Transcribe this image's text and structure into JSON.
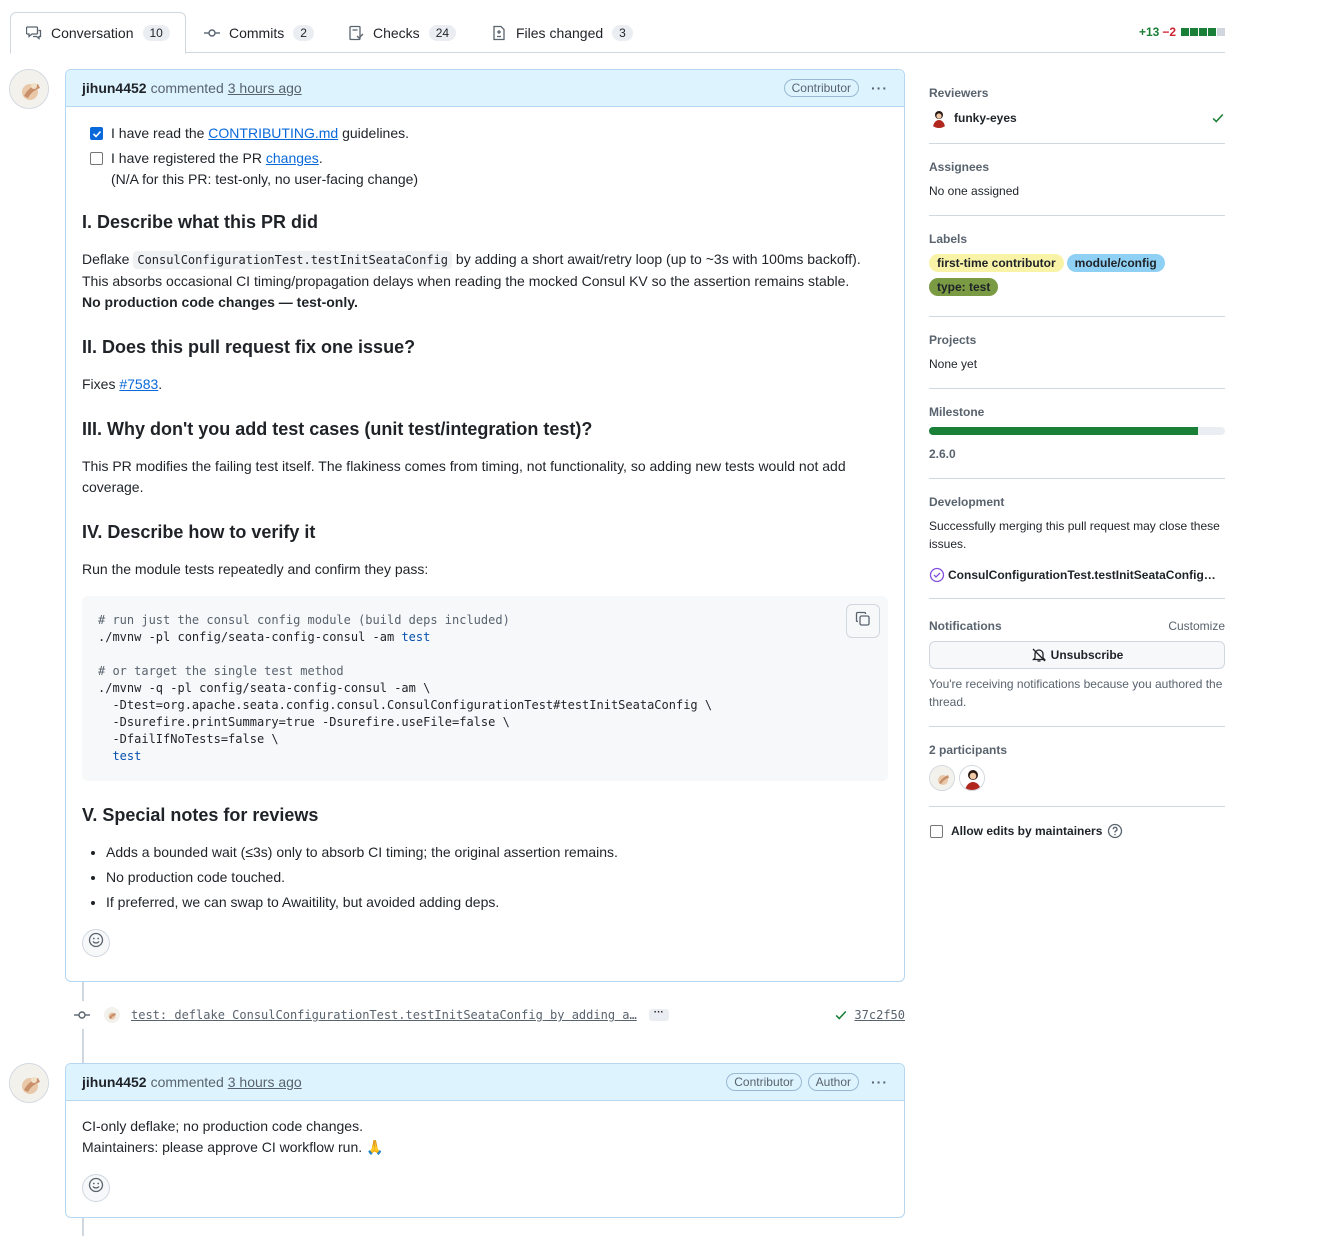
{
  "tabs": [
    {
      "label": "Conversation",
      "count": "10",
      "icon": "comment-discussion-icon"
    },
    {
      "label": "Commits",
      "count": "2",
      "icon": "git-commit-icon"
    },
    {
      "label": "Checks",
      "count": "24",
      "icon": "checklist-icon"
    },
    {
      "label": "Files changed",
      "count": "3",
      "icon": "file-diff-icon"
    }
  ],
  "diffstat": {
    "additions": "+13",
    "deletions": "−2"
  },
  "comment1": {
    "author": "jihun4452",
    "verb": "commented",
    "time": "3 hours ago",
    "badge": "Contributor",
    "check1_pre": "I have read the",
    "check1_link": "CONTRIBUTING.md",
    "check1_post": "guidelines.",
    "check2_pre": "I have registered the PR",
    "check2_link": "changes",
    "check2_note": "(N/A for this PR: test-only, no user-facing change)",
    "h1": "I. Describe what this PR did",
    "p1_pre": "Deflake",
    "p1_code": "ConsulConfigurationTest.testInitSeataConfig",
    "p1_post": "by adding a short await/retry loop (up to ~3s with 100ms backoff). This absorbs occasional CI timing/propagation delays when reading the mocked Consul KV so the assertion remains stable.",
    "p1_bold": "No production code changes — test-only.",
    "h2": "II. Does this pull request fix one issue?",
    "p2_pre": "Fixes",
    "p2_link": "#7583",
    "h3": "III. Why don't you add test cases (unit test/integration test)?",
    "p3": "This PR modifies the failing test itself. The flakiness comes from timing, not functionality, so adding new tests would not add coverage.",
    "h4": "IV. Describe how to verify it",
    "p4": "Run the module tests repeatedly and confirm they pass:",
    "code": {
      "c1": "# run just the consul config module (build deps included)",
      "l1": "./mvnw -pl config/seata-config-consul -am ",
      "l1_kw": "test",
      "c2": "# or target the single test method",
      "l2": "./mvnw -q -pl config/seata-config-consul -am \\",
      "l3": "  -Dtest=org.apache.seata.config.consul.ConsulConfigurationTest#testInitSeataConfig \\",
      "l4": "  -Dsurefire.printSummary=true -Dsurefire.useFile=false \\",
      "l5": "  -DfailIfNoTests=false \\",
      "l6_kw": "test"
    },
    "h5": "V. Special notes for reviews",
    "bullets": [
      "Adds a bounded wait (≤3s) only to absorb CI timing; the original assertion remains.",
      "No production code touched.",
      "If preferred, we can swap to Awaitility, but avoided adding deps."
    ]
  },
  "commit": {
    "message": "test: deflake ConsulConfigurationTest.testInitSeataConfig by adding a…",
    "ellipsis": "···",
    "sha": "37c2f50"
  },
  "comment2": {
    "author": "jihun4452",
    "verb": "commented",
    "time": "3 hours ago",
    "badge1": "Contributor",
    "badge2": "Author",
    "line1": "CI-only deflake; no production code changes.",
    "line2": "Maintainers: please approve CI workflow run. 🙏"
  },
  "sidebar": {
    "reviewers_title": "Reviewers",
    "reviewer": "funky-eyes",
    "assignees_title": "Assignees",
    "assignees_value": "No one assigned",
    "labels_title": "Labels",
    "labels": [
      {
        "name": "first-time contributor",
        "bg": "#f9f3a8",
        "fg": "#1f2328"
      },
      {
        "name": "module/config",
        "bg": "#8fd0f5",
        "fg": "#1f2328"
      },
      {
        "name": "type: test",
        "bg": "#7a9a43",
        "fg": "#1f2328"
      }
    ],
    "projects_title": "Projects",
    "projects_value": "None yet",
    "milestone_title": "Milestone",
    "milestone_name": "2.6.0",
    "milestone_progress": 0.91,
    "development_title": "Development",
    "development_text": "Successfully merging this pull request may close these issues.",
    "development_issue": "ConsulConfigurationTest.testInitSeataConfig…",
    "notifications_title": "Notifications",
    "customize": "Customize",
    "unsubscribe": "Unsubscribe",
    "notif_reason": "You're receiving notifications because you authored the thread.",
    "participants_title": "2 participants",
    "allow_edits": "Allow edits by maintainers"
  },
  "colors": {
    "accent": "#0969da",
    "success": "#1a7f37",
    "danger": "#cf222e",
    "header_bg": "#ddf4ff"
  }
}
